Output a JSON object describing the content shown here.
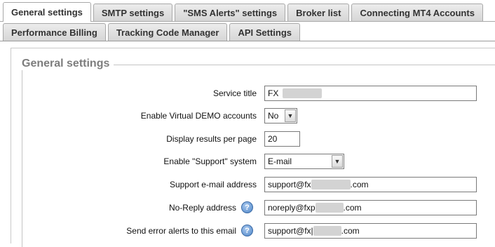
{
  "tabs_row1": [
    {
      "label": "General settings",
      "active": true
    },
    {
      "label": "SMTP settings",
      "active": false
    },
    {
      "label": "\"SMS Alerts\" settings",
      "active": false
    },
    {
      "label": "Broker list",
      "active": false
    },
    {
      "label": "Connecting MT4 Accounts",
      "active": false
    }
  ],
  "tabs_row2": [
    {
      "label": "Performance Billing"
    },
    {
      "label": "Tracking Code Manager"
    },
    {
      "label": "API Settings"
    }
  ],
  "section": {
    "title": "General settings"
  },
  "fields": {
    "service_title": {
      "label": "Service title",
      "value": "FX"
    },
    "virtual_demo": {
      "label": "Enable Virtual DEMO accounts",
      "value": "No"
    },
    "results_per_page": {
      "label": "Display results per page",
      "value": "20"
    },
    "support_system": {
      "label": "Enable \"Support\" system",
      "value": "E-mail"
    },
    "support_email": {
      "label": "Support e-mail address",
      "value_prefix": "support@fx",
      "value_suffix": ".com"
    },
    "noreply": {
      "label": "No-Reply address",
      "value_prefix": "noreply@fxp",
      "value_suffix": ".com",
      "help": "?"
    },
    "error_alerts": {
      "label": "Send error alerts to this email",
      "value_prefix": "support@fx|",
      "value_suffix": ".com",
      "help": "?"
    }
  },
  "icons": {
    "help": "help-icon",
    "dropdown": "chevron-down-icon"
  },
  "colors": {
    "legend": "#7d7d7d",
    "help_icon": "#4f86c8",
    "tab_bg": "#dcdcdc"
  }
}
